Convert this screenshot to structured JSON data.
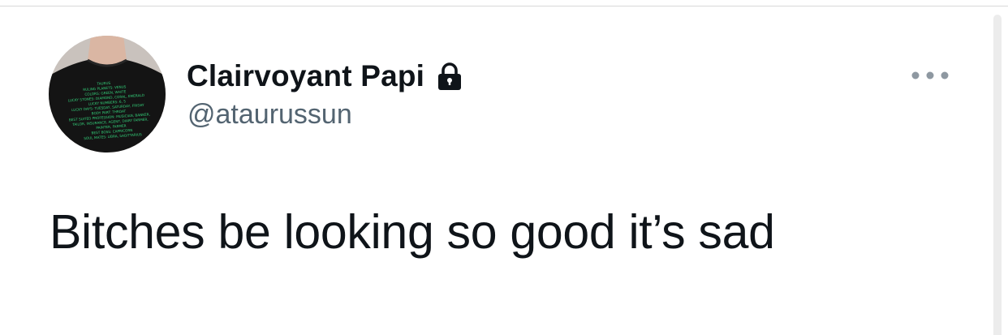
{
  "tweet": {
    "author": {
      "display_name": "Clairvoyant Papi",
      "handle": "@ataurussun",
      "protected_icon": "lock-icon",
      "avatar_shirt_print": [
        "TAURUS",
        "RULING PLANETS: VENUS",
        "COLORS: GREEN, WHITE",
        "LUCKY STONES: DIAMOND, CORAL, EMERALD",
        "LUCKY NUMBERS: 6, 5",
        "LUCKY DAYS: TUESDAY, SATURDAY, FRIDAY",
        "BODY PART: THROAT",
        "BEST SUITED PROFESSION: MUSICIAN, BANKER,",
        "TAILOR, INSURANCE, AGENT, DIARY FARMER,",
        "PAINTER, FARMER",
        "BEST BOSS: CAPRICORN",
        "SOUL MATES: LIBRA, SAGITTARIUS"
      ]
    },
    "text": "Bitches be looking so good it’s sad",
    "more_icon": "ellipsis-icon"
  },
  "colors": {
    "primary_text": "#0f1419",
    "secondary_text": "#536471",
    "shirt_print": "#34d07a",
    "divider": "#d9d9d9"
  }
}
